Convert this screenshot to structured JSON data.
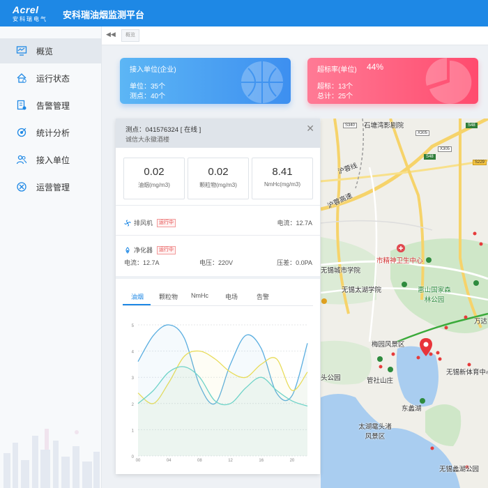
{
  "header": {
    "logo_name": "Acrel",
    "logo_sub": "安科瑞电气",
    "title": "安科瑞油烟监测平台"
  },
  "sidebar": {
    "items": [
      {
        "label": "概览",
        "icon": "monitor-icon"
      },
      {
        "label": "运行状态",
        "icon": "home-status-icon"
      },
      {
        "label": "告警管理",
        "icon": "alarm-doc-icon"
      },
      {
        "label": "统计分析",
        "icon": "target-icon"
      },
      {
        "label": "接入单位",
        "icon": "users-icon"
      },
      {
        "label": "运营管理",
        "icon": "tools-icon"
      }
    ],
    "active_index": 0
  },
  "tabbar": {
    "collapse_icon": "double-left-arrow-icon",
    "tab_label": "概览"
  },
  "cards": {
    "access": {
      "title": "接入单位(企业)",
      "line1": "单位：35个",
      "line2": "测点：40个",
      "color": "#3d8ff0"
    },
    "over": {
      "title": "超标率(单位)",
      "rate": "44%",
      "line1": "超标：13个",
      "line2": "总计：25个",
      "color": "#ff4b6e"
    }
  },
  "panel": {
    "point": "测点：041576324 [ 在线 ]",
    "site": "诚信大永徽酒楼",
    "metrics": [
      {
        "value": "0.02",
        "label": "油烟(mg/m3)"
      },
      {
        "value": "0.02",
        "label": "颗粒物(mg/m3)"
      },
      {
        "value": "8.41",
        "label": "NmHc(mg/m3)"
      }
    ],
    "fan": {
      "label": "排风机",
      "status": "运行中",
      "current": "电流：12.7A"
    },
    "purifier": {
      "label": "净化器",
      "status": "运行中",
      "current": "电流：12.7A",
      "voltage": "电压：220V",
      "pressure": "压差：0.0PA"
    },
    "tabs": [
      "油烟",
      "颗粒物",
      "NmHc",
      "电场",
      "告警"
    ],
    "active_tab": 0
  },
  "chart_data": {
    "type": "line",
    "x_ticks": [
      "00",
      "04",
      "08",
      "12",
      "16",
      "20"
    ],
    "y_ticks": [
      "0",
      "1",
      "2",
      "3",
      "4",
      "5"
    ],
    "ylim": [
      0,
      5
    ],
    "grid": true,
    "series": [
      {
        "color": "#5aaee0",
        "x": [
          0,
          2,
          4,
          6,
          8,
          10,
          12,
          14,
          16,
          18,
          20,
          22
        ],
        "values": [
          3.6,
          4.6,
          5.0,
          4.5,
          2.7,
          2.0,
          3.5,
          4.6,
          4.1,
          2.4,
          2.3,
          4.3
        ]
      },
      {
        "color": "#e8dc5a",
        "x": [
          0,
          2,
          4,
          6,
          8,
          10,
          12,
          14,
          16,
          18,
          20,
          22
        ],
        "values": [
          2.4,
          2.0,
          2.8,
          3.8,
          4.0,
          3.7,
          3.2,
          3.0,
          3.5,
          3.7,
          2.5,
          3.2
        ]
      },
      {
        "color": "#6fd3c8",
        "x": [
          0,
          2,
          4,
          6,
          8,
          10,
          12,
          14,
          16,
          18,
          20,
          22
        ],
        "values": [
          2.0,
          2.5,
          3.2,
          3.4,
          3.0,
          2.1,
          2.0,
          2.6,
          3.0,
          2.5,
          2.1,
          1.9
        ]
      }
    ]
  },
  "map": {
    "labels": [
      {
        "text": "石塘湾影剧院",
        "cls": ""
      },
      {
        "text": "沪蓉线",
        "cls": ""
      },
      {
        "text": "沪蓉高速",
        "cls": ""
      },
      {
        "text": "市精神卫生中心",
        "cls": "red"
      },
      {
        "text": "无锡城市学院",
        "cls": ""
      },
      {
        "text": "无锡太湖学院",
        "cls": ""
      },
      {
        "text": "惠山国家森林公园",
        "cls": "green"
      },
      {
        "text": "万达",
        "cls": ""
      },
      {
        "text": "梅园风景区",
        "cls": ""
      },
      {
        "text": "无锡新体育中心",
        "cls": ""
      },
      {
        "text": "头公园",
        "cls": ""
      },
      {
        "text": "管社山庄",
        "cls": ""
      },
      {
        "text": "东蠡湖",
        "cls": ""
      },
      {
        "text": "太湖鼋头渚风景区",
        "cls": ""
      },
      {
        "text": "无锡蠡湖公园",
        "cls": ""
      }
    ],
    "shields": [
      "S340",
      "X305",
      "X305",
      "S48",
      "S48",
      "S229"
    ],
    "marker_icon": "map-pin-icon"
  }
}
